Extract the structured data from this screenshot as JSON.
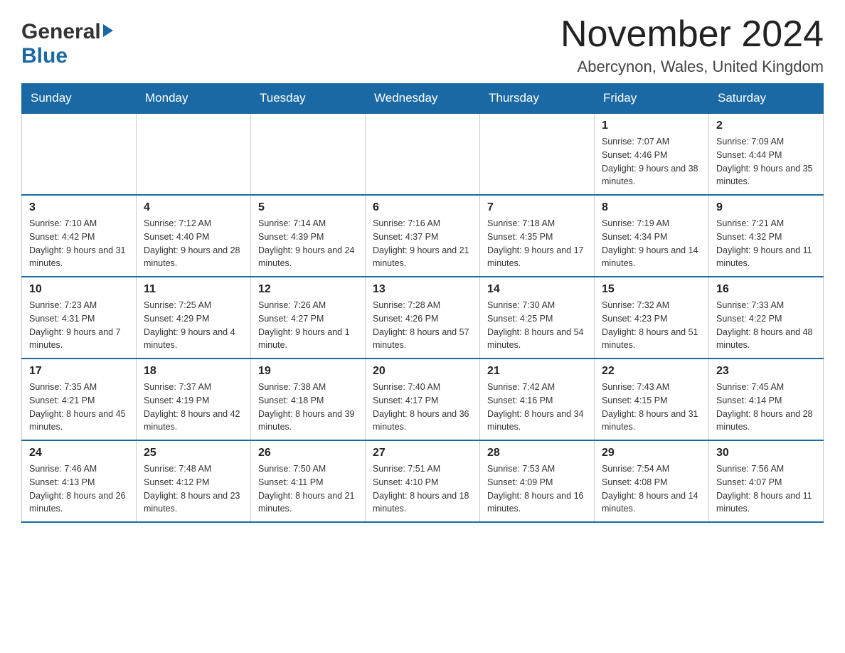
{
  "header": {
    "logo_general": "General",
    "logo_blue": "Blue",
    "month_title": "November 2024",
    "location": "Abercynon, Wales, United Kingdom"
  },
  "days_of_week": [
    "Sunday",
    "Monday",
    "Tuesday",
    "Wednesday",
    "Thursday",
    "Friday",
    "Saturday"
  ],
  "weeks": [
    [
      {
        "day": "",
        "info": ""
      },
      {
        "day": "",
        "info": ""
      },
      {
        "day": "",
        "info": ""
      },
      {
        "day": "",
        "info": ""
      },
      {
        "day": "",
        "info": ""
      },
      {
        "day": "1",
        "info": "Sunrise: 7:07 AM\nSunset: 4:46 PM\nDaylight: 9 hours and 38 minutes."
      },
      {
        "day": "2",
        "info": "Sunrise: 7:09 AM\nSunset: 4:44 PM\nDaylight: 9 hours and 35 minutes."
      }
    ],
    [
      {
        "day": "3",
        "info": "Sunrise: 7:10 AM\nSunset: 4:42 PM\nDaylight: 9 hours and 31 minutes."
      },
      {
        "day": "4",
        "info": "Sunrise: 7:12 AM\nSunset: 4:40 PM\nDaylight: 9 hours and 28 minutes."
      },
      {
        "day": "5",
        "info": "Sunrise: 7:14 AM\nSunset: 4:39 PM\nDaylight: 9 hours and 24 minutes."
      },
      {
        "day": "6",
        "info": "Sunrise: 7:16 AM\nSunset: 4:37 PM\nDaylight: 9 hours and 21 minutes."
      },
      {
        "day": "7",
        "info": "Sunrise: 7:18 AM\nSunset: 4:35 PM\nDaylight: 9 hours and 17 minutes."
      },
      {
        "day": "8",
        "info": "Sunrise: 7:19 AM\nSunset: 4:34 PM\nDaylight: 9 hours and 14 minutes."
      },
      {
        "day": "9",
        "info": "Sunrise: 7:21 AM\nSunset: 4:32 PM\nDaylight: 9 hours and 11 minutes."
      }
    ],
    [
      {
        "day": "10",
        "info": "Sunrise: 7:23 AM\nSunset: 4:31 PM\nDaylight: 9 hours and 7 minutes."
      },
      {
        "day": "11",
        "info": "Sunrise: 7:25 AM\nSunset: 4:29 PM\nDaylight: 9 hours and 4 minutes."
      },
      {
        "day": "12",
        "info": "Sunrise: 7:26 AM\nSunset: 4:27 PM\nDaylight: 9 hours and 1 minute."
      },
      {
        "day": "13",
        "info": "Sunrise: 7:28 AM\nSunset: 4:26 PM\nDaylight: 8 hours and 57 minutes."
      },
      {
        "day": "14",
        "info": "Sunrise: 7:30 AM\nSunset: 4:25 PM\nDaylight: 8 hours and 54 minutes."
      },
      {
        "day": "15",
        "info": "Sunrise: 7:32 AM\nSunset: 4:23 PM\nDaylight: 8 hours and 51 minutes."
      },
      {
        "day": "16",
        "info": "Sunrise: 7:33 AM\nSunset: 4:22 PM\nDaylight: 8 hours and 48 minutes."
      }
    ],
    [
      {
        "day": "17",
        "info": "Sunrise: 7:35 AM\nSunset: 4:21 PM\nDaylight: 8 hours and 45 minutes."
      },
      {
        "day": "18",
        "info": "Sunrise: 7:37 AM\nSunset: 4:19 PM\nDaylight: 8 hours and 42 minutes."
      },
      {
        "day": "19",
        "info": "Sunrise: 7:38 AM\nSunset: 4:18 PM\nDaylight: 8 hours and 39 minutes."
      },
      {
        "day": "20",
        "info": "Sunrise: 7:40 AM\nSunset: 4:17 PM\nDaylight: 8 hours and 36 minutes."
      },
      {
        "day": "21",
        "info": "Sunrise: 7:42 AM\nSunset: 4:16 PM\nDaylight: 8 hours and 34 minutes."
      },
      {
        "day": "22",
        "info": "Sunrise: 7:43 AM\nSunset: 4:15 PM\nDaylight: 8 hours and 31 minutes."
      },
      {
        "day": "23",
        "info": "Sunrise: 7:45 AM\nSunset: 4:14 PM\nDaylight: 8 hours and 28 minutes."
      }
    ],
    [
      {
        "day": "24",
        "info": "Sunrise: 7:46 AM\nSunset: 4:13 PM\nDaylight: 8 hours and 26 minutes."
      },
      {
        "day": "25",
        "info": "Sunrise: 7:48 AM\nSunset: 4:12 PM\nDaylight: 8 hours and 23 minutes."
      },
      {
        "day": "26",
        "info": "Sunrise: 7:50 AM\nSunset: 4:11 PM\nDaylight: 8 hours and 21 minutes."
      },
      {
        "day": "27",
        "info": "Sunrise: 7:51 AM\nSunset: 4:10 PM\nDaylight: 8 hours and 18 minutes."
      },
      {
        "day": "28",
        "info": "Sunrise: 7:53 AM\nSunset: 4:09 PM\nDaylight: 8 hours and 16 minutes."
      },
      {
        "day": "29",
        "info": "Sunrise: 7:54 AM\nSunset: 4:08 PM\nDaylight: 8 hours and 14 minutes."
      },
      {
        "day": "30",
        "info": "Sunrise: 7:56 AM\nSunset: 4:07 PM\nDaylight: 8 hours and 11 minutes."
      }
    ]
  ]
}
